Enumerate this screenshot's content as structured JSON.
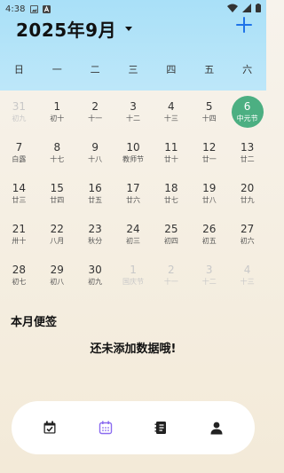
{
  "status": {
    "time": "4:38"
  },
  "header": {
    "month_title": "2025年9月"
  },
  "weekdays": [
    "日",
    "一",
    "二",
    "三",
    "四",
    "五",
    "六"
  ],
  "calendar": [
    [
      {
        "n": "31",
        "s": "初九",
        "dim": true
      },
      {
        "n": "1",
        "s": "初十"
      },
      {
        "n": "2",
        "s": "十一"
      },
      {
        "n": "3",
        "s": "十二"
      },
      {
        "n": "4",
        "s": "十三"
      },
      {
        "n": "5",
        "s": "十四"
      },
      {
        "n": "6",
        "s": "中元节",
        "today": true
      }
    ],
    [
      {
        "n": "7",
        "s": "白露"
      },
      {
        "n": "8",
        "s": "十七"
      },
      {
        "n": "9",
        "s": "十八"
      },
      {
        "n": "10",
        "s": "教师节"
      },
      {
        "n": "11",
        "s": "廿十"
      },
      {
        "n": "12",
        "s": "廿一"
      },
      {
        "n": "13",
        "s": "廿二"
      }
    ],
    [
      {
        "n": "14",
        "s": "廿三"
      },
      {
        "n": "15",
        "s": "廿四"
      },
      {
        "n": "16",
        "s": "廿五"
      },
      {
        "n": "17",
        "s": "廿六"
      },
      {
        "n": "18",
        "s": "廿七"
      },
      {
        "n": "19",
        "s": "廿八"
      },
      {
        "n": "20",
        "s": "廿九"
      }
    ],
    [
      {
        "n": "21",
        "s": "卅十"
      },
      {
        "n": "22",
        "s": "八月"
      },
      {
        "n": "23",
        "s": "秋分"
      },
      {
        "n": "24",
        "s": "初三"
      },
      {
        "n": "25",
        "s": "初四"
      },
      {
        "n": "26",
        "s": "初五"
      },
      {
        "n": "27",
        "s": "初六"
      }
    ],
    [
      {
        "n": "28",
        "s": "初七"
      },
      {
        "n": "29",
        "s": "初八"
      },
      {
        "n": "30",
        "s": "初九"
      },
      {
        "n": "1",
        "s": "国庆节",
        "dim": true
      },
      {
        "n": "2",
        "s": "十一",
        "dim": true
      },
      {
        "n": "3",
        "s": "十二",
        "dim": true
      },
      {
        "n": "4",
        "s": "十三",
        "dim": true
      }
    ]
  ],
  "memo": {
    "title": "本月便签",
    "empty": "还未添加数据哦!"
  },
  "tabs": [
    {
      "icon": "calendar-check-icon"
    },
    {
      "icon": "calendar-grid-icon",
      "active": true
    },
    {
      "icon": "notebook-icon"
    },
    {
      "icon": "person-icon"
    }
  ],
  "colors": {
    "accent": "#1e73e8",
    "today": "#4caf82",
    "tab_active": "#8b6cf0"
  }
}
